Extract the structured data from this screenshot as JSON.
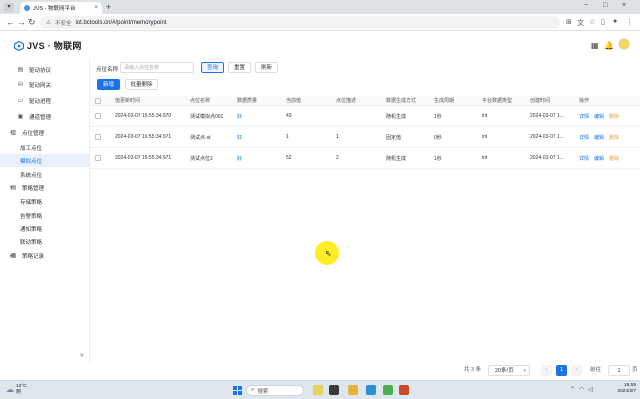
{
  "browser": {
    "tab_title": "JVS - 物联网平台",
    "new_tab_symbol": "+",
    "close_tab_symbol": "×",
    "security_label": "不安全",
    "url": "iot.bctools.cn/#/point/memorypoint",
    "window_controls": [
      "−",
      "□",
      "×"
    ]
  },
  "header": {
    "logo_text": "JVS · 物联网"
  },
  "sidebar": {
    "items": [
      {
        "label": "驱动协议",
        "icon": "protocol-icon"
      },
      {
        "label": "驱动网关",
        "icon": "gateway-icon"
      },
      {
        "label": "驱动进程",
        "icon": "process-icon"
      },
      {
        "label": "通道管理",
        "icon": "channel-icon"
      },
      {
        "label": "点位管理",
        "icon": "point-icon",
        "group": true,
        "expanded": true
      },
      {
        "label": "加工点位",
        "sub": true
      },
      {
        "label": "模拟点位",
        "sub": true,
        "active": true
      },
      {
        "label": "系统点位",
        "sub": true
      },
      {
        "label": "策略管理",
        "icon": "strategy-icon",
        "group": true,
        "expanded": true
      },
      {
        "label": "存储策略",
        "sub": true
      },
      {
        "label": "告警策略",
        "sub": true
      },
      {
        "label": "通知策略",
        "sub": true
      },
      {
        "label": "联动策略",
        "sub": true
      },
      {
        "label": "策略记录",
        "icon": "record-icon",
        "group": true,
        "expanded": false
      }
    ],
    "collapse_symbol": "«"
  },
  "filter": {
    "label": "点位名称",
    "placeholder": "请输入点位名称",
    "query_button": "查询",
    "reset_button": "重置",
    "refresh_button": "刷新"
  },
  "actions": {
    "add_button": "新增",
    "batch_delete_button": "批量删除"
  },
  "table": {
    "columns": [
      "值更新时间",
      "点位名称",
      "数据质量",
      "当前值",
      "点位描述",
      "数据生成方式",
      "生成周期",
      "平台数据类型",
      "创建时间",
      "操作"
    ],
    "rows": [
      {
        "update_time": "2024-03-07 16:55:34.970",
        "name": "测试模拟点001",
        "quality": "好",
        "value": "43",
        "desc": "",
        "gen_mode": "随机生成",
        "period": "1秒",
        "type": "int",
        "created": "2024-03-07 1…"
      },
      {
        "update_time": "2024-03-07 16:55:34.971",
        "name": "测试点-st",
        "quality": "好",
        "value": "1",
        "desc": "1",
        "gen_mode": "固定值",
        "period": "0秒",
        "type": "int",
        "created": "2024-03-07 1…"
      },
      {
        "update_time": "2024-03-07 16:55:34.971",
        "name": "测试点位2",
        "quality": "好",
        "value": "52",
        "desc": "2",
        "gen_mode": "随机生成",
        "period": "1秒",
        "type": "int",
        "created": "2024-03-07 1…"
      }
    ],
    "op_labels": {
      "detail": "详情",
      "edit": "编辑",
      "delete": "删除"
    }
  },
  "pagination": {
    "total_text": "共 3 条",
    "page_size": "20条/页",
    "current_page": "1",
    "goto_label": "前往",
    "goto_value": "1",
    "page_unit": "页"
  },
  "taskbar": {
    "temperature": "12°C",
    "weather": "阴",
    "search_placeholder": "搜索",
    "time": "16:55",
    "date": "2024/3/7"
  },
  "colors": {
    "primary": "#1a73e8",
    "danger": "#e6a23c",
    "cursor_highlight": "#ffeb00"
  }
}
